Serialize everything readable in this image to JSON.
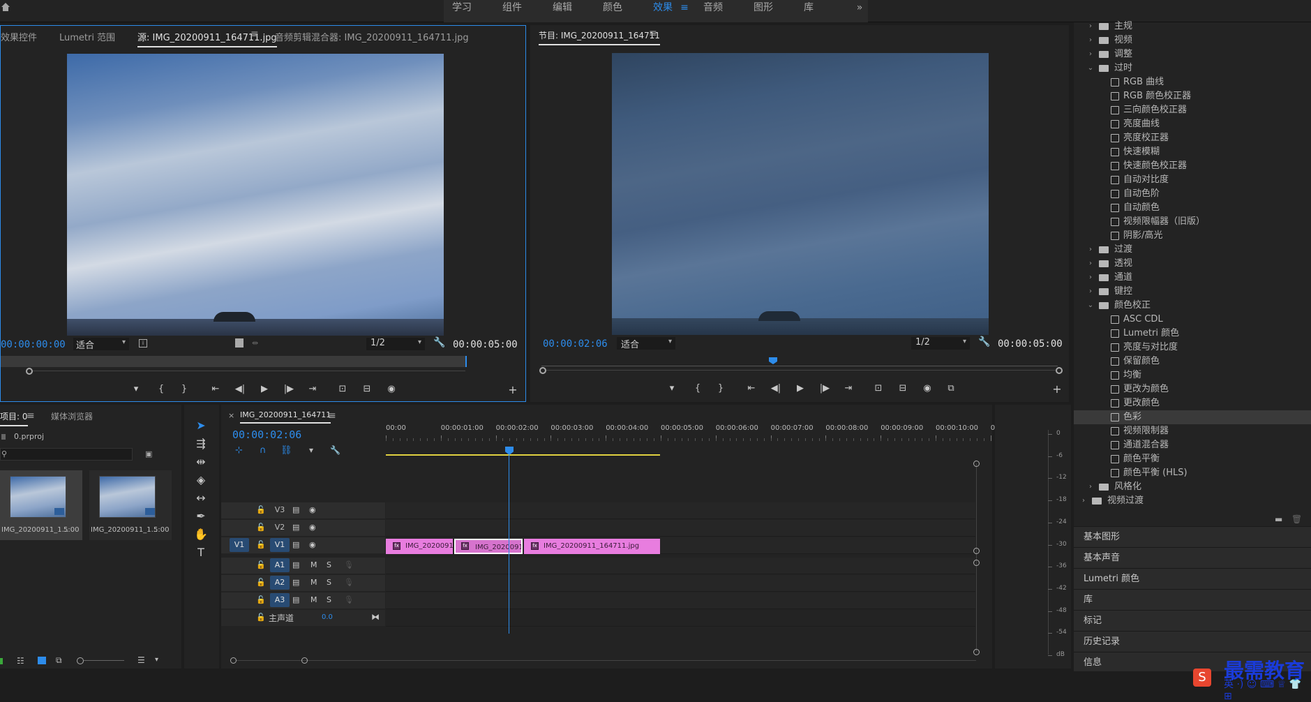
{
  "workspaces": [
    {
      "label": "学习",
      "active": false
    },
    {
      "label": "组件",
      "active": false
    },
    {
      "label": "编辑",
      "active": false
    },
    {
      "label": "颜色",
      "active": false
    },
    {
      "label": "效果",
      "active": true
    },
    {
      "label": "音频",
      "active": false
    },
    {
      "label": "图形",
      "active": false
    },
    {
      "label": "库",
      "active": false
    }
  ],
  "workspace_menu": "≡",
  "workspace_more": "»",
  "source_panel": {
    "tabs": [
      "效果控件",
      "Lumetri 范围",
      "源: IMG_20200911_164711.jpg",
      "音频剪辑混合器: IMG_20200911_164711.jpg"
    ],
    "active_tab": 2,
    "timecode_current": "00:00:00:00",
    "fit_label": "适合",
    "resolution": "1/2",
    "timecode_duration": "00:00:05:00"
  },
  "program_panel": {
    "title": "节目: IMG_20200911_164711",
    "timecode_current": "00:00:02:06",
    "fit_label": "适合",
    "resolution": "1/2",
    "timecode_duration": "00:00:05:00"
  },
  "transport": {
    "marker": "▾",
    "in": "{",
    "out": "}",
    "goto_in": "⇤",
    "step_back": "◀|",
    "play": "▶",
    "step_fwd": "|▶",
    "goto_out": "⇥",
    "lift": "⊡",
    "extract": "⊟",
    "export_frame": "◉",
    "add": "+"
  },
  "effects_tree": [
    {
      "level": 1,
      "type": "folder",
      "open": false,
      "label": "主规"
    },
    {
      "level": 1,
      "type": "folder",
      "open": false,
      "label": "视频"
    },
    {
      "level": 1,
      "type": "folder",
      "open": false,
      "label": "调整"
    },
    {
      "level": 1,
      "type": "folder",
      "open": true,
      "label": "过时"
    },
    {
      "level": 2,
      "type": "fx",
      "label": "RGB 曲线"
    },
    {
      "level": 2,
      "type": "fx",
      "label": "RGB 颜色校正器"
    },
    {
      "level": 2,
      "type": "fx",
      "label": "三向颜色校正器"
    },
    {
      "level": 2,
      "type": "fx",
      "label": "亮度曲线"
    },
    {
      "level": 2,
      "type": "fx",
      "label": "亮度校正器"
    },
    {
      "level": 2,
      "type": "fx",
      "label": "快速模糊"
    },
    {
      "level": 2,
      "type": "fx",
      "label": "快速颜色校正器"
    },
    {
      "level": 2,
      "type": "fx",
      "label": "自动对比度"
    },
    {
      "level": 2,
      "type": "fx",
      "label": "自动色阶"
    },
    {
      "level": 2,
      "type": "fx",
      "label": "自动颜色"
    },
    {
      "level": 2,
      "type": "fx",
      "label": "视频限幅器（旧版）"
    },
    {
      "level": 2,
      "type": "fx",
      "label": "阴影/高光"
    },
    {
      "level": 1,
      "type": "folder",
      "open": false,
      "label": "过渡"
    },
    {
      "level": 1,
      "type": "folder",
      "open": false,
      "label": "透视"
    },
    {
      "level": 1,
      "type": "folder",
      "open": false,
      "label": "通道"
    },
    {
      "level": 1,
      "type": "folder",
      "open": false,
      "label": "键控"
    },
    {
      "level": 1,
      "type": "folder",
      "open": true,
      "label": "颜色校正"
    },
    {
      "level": 2,
      "type": "fx",
      "label": "ASC CDL"
    },
    {
      "level": 2,
      "type": "fx",
      "label": "Lumetri 颜色"
    },
    {
      "level": 2,
      "type": "fx",
      "label": "亮度与对比度"
    },
    {
      "level": 2,
      "type": "fx",
      "label": "保留颜色"
    },
    {
      "level": 2,
      "type": "fx",
      "label": "均衡"
    },
    {
      "level": 2,
      "type": "fx",
      "label": "更改为颜色"
    },
    {
      "level": 2,
      "type": "fx",
      "label": "更改颜色"
    },
    {
      "level": 2,
      "type": "fx",
      "label": "色彩",
      "selected": true
    },
    {
      "level": 2,
      "type": "fx",
      "label": "视频限制器"
    },
    {
      "level": 2,
      "type": "fx",
      "label": "通道混合器"
    },
    {
      "level": 2,
      "type": "fx",
      "label": "颜色平衡"
    },
    {
      "level": 2,
      "type": "fx",
      "label": "颜色平衡 (HLS)"
    },
    {
      "level": 1,
      "type": "folder",
      "open": false,
      "label": "风格化"
    },
    {
      "level": 0,
      "type": "folder",
      "open": false,
      "label": "视频过渡"
    }
  ],
  "side_panels": [
    "基本图形",
    "基本声音",
    "Lumetri 颜色",
    "库",
    "标记",
    "历史记录",
    "信息"
  ],
  "project_panel": {
    "tabs": [
      "项目: 0",
      "媒体浏览器"
    ],
    "file": "0.prproj",
    "items": [
      {
        "name": "IMG_20200911_1...",
        "duration": "5:00"
      },
      {
        "name": "IMG_20200911_1...",
        "duration": "5:00"
      }
    ]
  },
  "timeline": {
    "tab": "IMG_20200911_164711",
    "timecode": "00:00:02:06",
    "ruler": [
      "00:00",
      "00:00:01:00",
      "00:00:02:00",
      "00:00:03:00",
      "00:00:04:00",
      "00:00:05:00",
      "00:00:06:00",
      "00:00:07:00",
      "00:00:08:00",
      "00:00:09:00",
      "00:00:10:00",
      "0"
    ],
    "video_tracks": [
      "V3",
      "V2",
      "V1"
    ],
    "audio_tracks": [
      "A1",
      "A2",
      "A3"
    ],
    "source_patch": "V1",
    "master_label": "主声道",
    "master_value": "0.0",
    "mute": "M",
    "solo": "S",
    "clips": [
      {
        "label": "IMG_20200911"
      },
      {
        "label": "IMG_20200911"
      },
      {
        "label": "IMG_20200911_164711.jpg"
      }
    ]
  },
  "audio_meter": [
    "0",
    "-6",
    "-12",
    "-18",
    "-24",
    "-30",
    "-36",
    "-42",
    "-48",
    "-54",
    "dB"
  ],
  "watermark": {
    "text": "最需教育",
    "ime": "英 ·) ☺ ⌨ ♕ 👕 ⊞"
  }
}
